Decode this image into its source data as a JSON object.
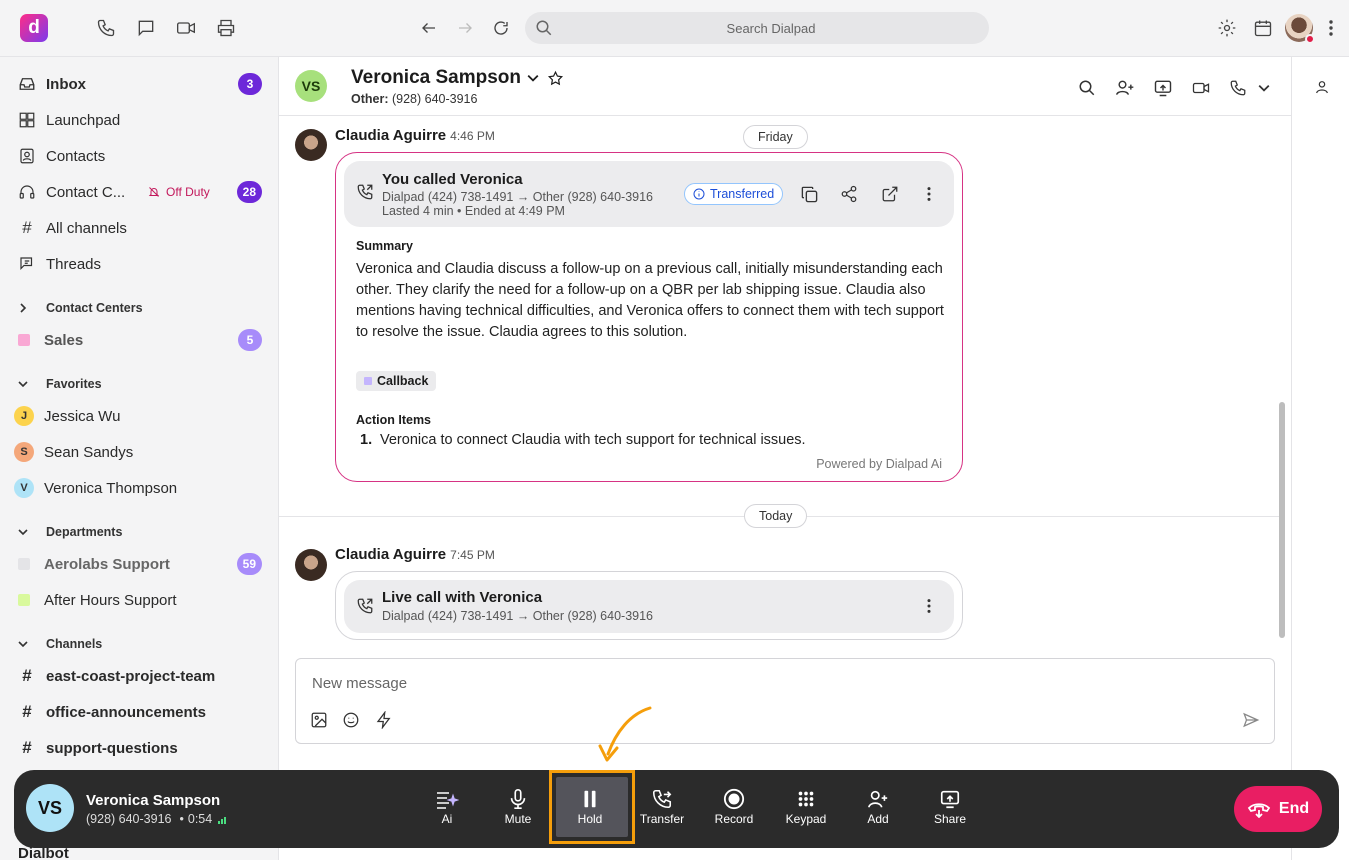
{
  "topbar": {
    "logo_letter": "d",
    "search_placeholder": "Search Dialpad"
  },
  "sidebar": {
    "nav": [
      {
        "label": "Inbox",
        "badge": "3"
      },
      {
        "label": "Launchpad"
      },
      {
        "label": "Contacts"
      },
      {
        "label": "Contact C...",
        "status": "Off Duty",
        "badge": "28"
      },
      {
        "label": "All channels"
      },
      {
        "label": "Threads"
      }
    ],
    "contact_centers_header": "Contact Centers",
    "sales": {
      "label": "Sales",
      "badge": "5",
      "color": "#f472b6"
    },
    "favorites_header": "Favorites",
    "favorites": [
      {
        "initial": "J",
        "name": "Jessica Wu",
        "color": "#fcd34d"
      },
      {
        "initial": "S",
        "name": "Sean Sandys",
        "color": "#f4a77a"
      },
      {
        "initial": "V",
        "name": "Veronica Thompson",
        "color": "#aee3f7"
      }
    ],
    "departments_header": "Departments",
    "departments": [
      {
        "name": "Aerolabs Support",
        "badge": "59",
        "color": "#e4e4e7"
      },
      {
        "name": "After Hours Support",
        "color": "#d9f99d"
      }
    ],
    "channels_header": "Channels",
    "channels": [
      "east-coast-project-team",
      "office-announcements",
      "support-questions"
    ],
    "peek_item": "Dialbot"
  },
  "chat": {
    "contact_initials": "VS",
    "contact_name": "Veronica Sampson",
    "contact_sub_label": "Other:",
    "contact_sub_number": "(928) 640-3916",
    "date_1": "Friday",
    "date_2": "Today",
    "msg1": {
      "sender": "Claudia Aguirre",
      "time": "4:46 PM",
      "call_title": "You called Veronica",
      "call_route": "Dialpad (424) 738-1491 → Other (928) 640-3916",
      "call_meta": "Lasted 4 min • Ended at 4:49 PM",
      "status": "Transferred",
      "summary_heading": "Summary",
      "summary": "Veronica and Claudia discuss a follow-up on a previous call, initially misunderstanding each other. They clarify the need for a follow-up on a QBR per lab shipping issue. Claudia also mentions having technical difficulties, and Veronica offers to connect them with tech support to resolve the issue. Claudia agrees to this solution.",
      "tag": "Callback",
      "action_heading": "Action Items",
      "action_num": "1.",
      "action_item": "Veronica to connect Claudia with tech support for technical issues.",
      "powered_by": "Powered by Dialpad Ai"
    },
    "msg2": {
      "sender": "Claudia Aguirre",
      "time": "7:45 PM",
      "call_title": "Live call with Veronica",
      "call_route": "Dialpad (424) 738-1491 → Other (928) 640-3916"
    },
    "composer_placeholder": "New message"
  },
  "callbar": {
    "initials": "VS",
    "name": "Veronica Sampson",
    "number": "(928) 640-3916",
    "duration": "0:54",
    "controls": [
      "Ai",
      "Mute",
      "Hold",
      "Transfer",
      "Record",
      "Keypad",
      "Add",
      "Share"
    ],
    "end_label": "End",
    "accent": "#f59e0b",
    "end_color": "#e91e63"
  }
}
